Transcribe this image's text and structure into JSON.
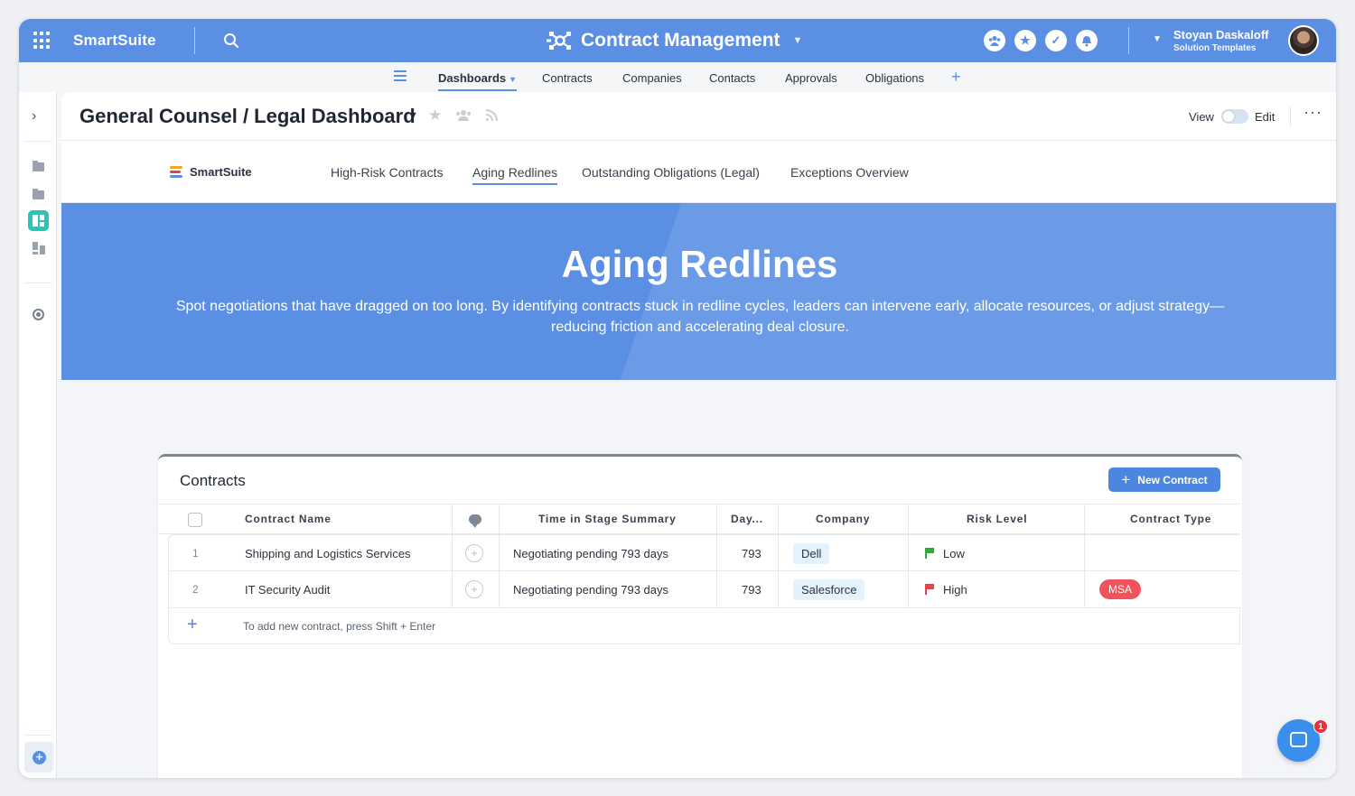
{
  "topbar": {
    "brand": "SmartSuite",
    "app_title": "Contract Management",
    "user_name": "Stoyan Daskaloff",
    "user_subtitle": "Solution Templates"
  },
  "nav": {
    "items": [
      {
        "label": "Dashboards",
        "active": true
      },
      {
        "label": "Contracts"
      },
      {
        "label": "Companies"
      },
      {
        "label": "Contacts"
      },
      {
        "label": "Approvals"
      },
      {
        "label": "Obligations"
      }
    ],
    "add_symbol": "+"
  },
  "page": {
    "title": "General Counsel / Legal Dashboard",
    "view_label": "View",
    "edit_label": "Edit",
    "more": "···"
  },
  "dashboard_tabs": {
    "logo_text": "SmartSuite",
    "tabs": [
      {
        "label": "High-Risk Contracts"
      },
      {
        "label": "Aging Redlines",
        "active": true
      },
      {
        "label": "Outstanding Obligations (Legal)"
      },
      {
        "label": "Exceptions Overview"
      }
    ]
  },
  "hero": {
    "title": "Aging Redlines",
    "description": "Spot negotiations that have dragged on too long. By identifying contracts stuck in redline cycles, leaders can intervene early, allocate resources, or adjust strategy—reducing friction and accelerating deal closure."
  },
  "contracts": {
    "title": "Contracts",
    "new_button": "New Contract",
    "columns": {
      "name": "Contract Name",
      "time": "Time in Stage Summary",
      "days": "Day...",
      "company": "Company",
      "risk": "Risk Level",
      "type": "Contract Type"
    },
    "rows": [
      {
        "num": "1",
        "name": "Shipping and Logistics Services",
        "time": "Negotiating pending 793 days",
        "days": "793",
        "company": "Dell",
        "risk": "Low",
        "type": ""
      },
      {
        "num": "2",
        "name": "IT Security Audit",
        "time": "Negotiating pending 793 days",
        "days": "793",
        "company": "Salesforce",
        "risk": "High",
        "type": "MSA"
      }
    ],
    "add_hint": "To add new contract, press Shift + Enter"
  },
  "chat_badge": "1",
  "colors": {
    "accent": "#5b8fe3",
    "teal": "#26c6b8",
    "risk_low": "#2eaa3c",
    "risk_high": "#e8414b",
    "msa": "#f1535d"
  }
}
